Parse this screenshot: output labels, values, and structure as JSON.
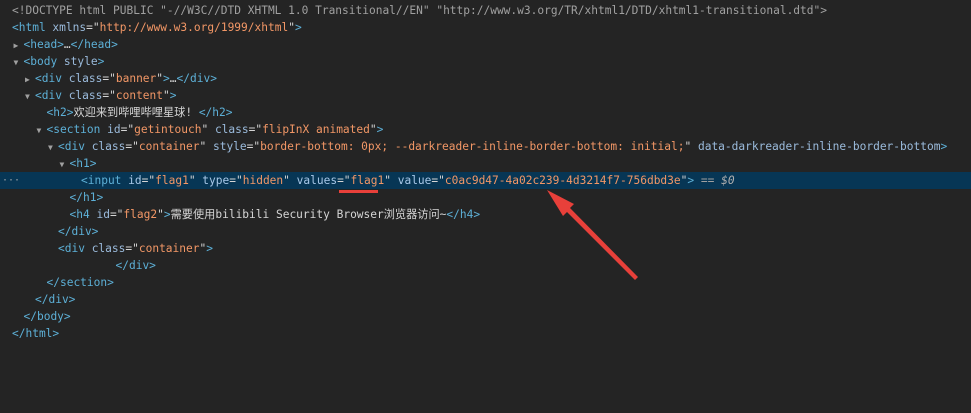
{
  "devtools": {
    "lines": [
      {
        "indent": 0,
        "toggle": "",
        "selected": false,
        "dots": "",
        "tokens": [
          {
            "k": "dim",
            "t": "<!DOCTYPE html PUBLIC \"-//W3C//DTD XHTML 1.0 Transitional//EN\" \"http://www.w3.org/TR/xhtml1/DTD/xhtml1-transitional.dtd\">"
          }
        ]
      },
      {
        "indent": 0,
        "toggle": "",
        "selected": false,
        "dots": "",
        "tokens": [
          {
            "k": "tag",
            "t": "<html"
          },
          {
            "k": "attr",
            "t": " xmlns"
          },
          {
            "k": "eq",
            "t": "=\""
          },
          {
            "k": "val",
            "t": "http://www.w3.org/1999/xhtml"
          },
          {
            "k": "eq",
            "t": "\""
          },
          {
            "k": "tag",
            "t": ">"
          }
        ]
      },
      {
        "indent": 1,
        "toggle": "▶",
        "selected": false,
        "dots": "",
        "tokens": [
          {
            "k": "tag",
            "t": "<head>"
          },
          {
            "k": "text",
            "t": "…"
          },
          {
            "k": "tag",
            "t": "</head>"
          }
        ]
      },
      {
        "indent": 1,
        "toggle": "▼",
        "selected": false,
        "dots": "",
        "tokens": [
          {
            "k": "tag",
            "t": "<body"
          },
          {
            "k": "attr",
            "t": " style"
          },
          {
            "k": "tag",
            "t": ">"
          }
        ]
      },
      {
        "indent": 2,
        "toggle": "▶",
        "selected": false,
        "dots": "",
        "tokens": [
          {
            "k": "tag",
            "t": "<div"
          },
          {
            "k": "attr",
            "t": " class"
          },
          {
            "k": "eq",
            "t": "=\""
          },
          {
            "k": "val",
            "t": "banner"
          },
          {
            "k": "eq",
            "t": "\""
          },
          {
            "k": "tag",
            "t": ">"
          },
          {
            "k": "text",
            "t": "…"
          },
          {
            "k": "tag",
            "t": "</div>"
          }
        ]
      },
      {
        "indent": 2,
        "toggle": "▼",
        "selected": false,
        "dots": "",
        "tokens": [
          {
            "k": "tag",
            "t": "<div"
          },
          {
            "k": "attr",
            "t": " class"
          },
          {
            "k": "eq",
            "t": "=\""
          },
          {
            "k": "val",
            "t": "content"
          },
          {
            "k": "eq",
            "t": "\""
          },
          {
            "k": "tag",
            "t": ">"
          }
        ]
      },
      {
        "indent": 3,
        "toggle": "",
        "selected": false,
        "dots": "",
        "tokens": [
          {
            "k": "tag",
            "t": "<h2>"
          },
          {
            "k": "text",
            "t": "欢迎来到哔哩哔哩星球! "
          },
          {
            "k": "tag",
            "t": "</h2>"
          }
        ]
      },
      {
        "indent": 3,
        "toggle": "▼",
        "selected": false,
        "dots": "",
        "tokens": [
          {
            "k": "tag",
            "t": "<section"
          },
          {
            "k": "attr",
            "t": " id"
          },
          {
            "k": "eq",
            "t": "=\""
          },
          {
            "k": "val",
            "t": "getintouch"
          },
          {
            "k": "eq",
            "t": "\""
          },
          {
            "k": "attr",
            "t": " class"
          },
          {
            "k": "eq",
            "t": "=\""
          },
          {
            "k": "val",
            "t": "flipInX animated"
          },
          {
            "k": "eq",
            "t": "\""
          },
          {
            "k": "tag",
            "t": ">"
          }
        ]
      },
      {
        "indent": 4,
        "toggle": "▼",
        "selected": false,
        "dots": "",
        "tokens": [
          {
            "k": "tag",
            "t": "<div"
          },
          {
            "k": "attr",
            "t": " class"
          },
          {
            "k": "eq",
            "t": "=\""
          },
          {
            "k": "val",
            "t": "container"
          },
          {
            "k": "eq",
            "t": "\""
          },
          {
            "k": "attr",
            "t": " style"
          },
          {
            "k": "eq",
            "t": "=\""
          },
          {
            "k": "val",
            "t": "border-bottom: 0px; --darkreader-inline-border-bottom: initial;"
          },
          {
            "k": "eq",
            "t": "\""
          },
          {
            "k": "attr",
            "t": " data-darkreader-inline-border-bottom"
          },
          {
            "k": "tag",
            "t": ">"
          }
        ]
      },
      {
        "indent": 5,
        "toggle": "▼",
        "selected": false,
        "dots": "",
        "tokens": [
          {
            "k": "tag",
            "t": "<h1>"
          }
        ]
      },
      {
        "indent": 6,
        "toggle": "",
        "selected": true,
        "dots": "···",
        "tokens": [
          {
            "k": "tag",
            "t": "<input"
          },
          {
            "k": "attr",
            "t": " id"
          },
          {
            "k": "eq",
            "t": "=\""
          },
          {
            "k": "val",
            "t": "flag1"
          },
          {
            "k": "eq",
            "t": "\""
          },
          {
            "k": "attr",
            "t": " type"
          },
          {
            "k": "eq",
            "t": "=\""
          },
          {
            "k": "val",
            "t": "hidden"
          },
          {
            "k": "eq",
            "t": "\""
          },
          {
            "k": "attr",
            "t": " values"
          },
          {
            "k": "eq",
            "t": "=\""
          },
          {
            "k": "val",
            "t": "flag1"
          },
          {
            "k": "eq",
            "t": "\""
          },
          {
            "k": "attr",
            "t": " value"
          },
          {
            "k": "eq",
            "t": "=\""
          },
          {
            "k": "val",
            "t": "c0ac9d47-4a02c239-4d3214f7-756dbd3e"
          },
          {
            "k": "eq",
            "t": "\""
          },
          {
            "k": "tag",
            "t": ">"
          },
          {
            "k": "dim",
            "t": " == "
          },
          {
            "k": "dollar",
            "t": "$0"
          }
        ]
      },
      {
        "indent": 5,
        "toggle": "",
        "selected": false,
        "dots": "",
        "tokens": [
          {
            "k": "tag",
            "t": "</h1>"
          }
        ]
      },
      {
        "indent": 5,
        "toggle": "",
        "selected": false,
        "dots": "",
        "tokens": [
          {
            "k": "tag",
            "t": "<h4"
          },
          {
            "k": "attr",
            "t": " id"
          },
          {
            "k": "eq",
            "t": "=\""
          },
          {
            "k": "val",
            "t": "flag2"
          },
          {
            "k": "eq",
            "t": "\""
          },
          {
            "k": "tag",
            "t": ">"
          },
          {
            "k": "text",
            "t": "需要使用bilibili Security Browser浏览器访问~"
          },
          {
            "k": "tag",
            "t": "</h4>"
          }
        ]
      },
      {
        "indent": 4,
        "toggle": "",
        "selected": false,
        "dots": "",
        "tokens": [
          {
            "k": "tag",
            "t": "</div>"
          }
        ]
      },
      {
        "indent": 4,
        "toggle": "",
        "selected": false,
        "dots": "",
        "tokens": [
          {
            "k": "tag",
            "t": "<div"
          },
          {
            "k": "attr",
            "t": " class"
          },
          {
            "k": "eq",
            "t": "=\""
          },
          {
            "k": "val",
            "t": "container"
          },
          {
            "k": "eq",
            "t": "\""
          },
          {
            "k": "tag",
            "t": ">"
          }
        ]
      },
      {
        "indent": 9,
        "toggle": "",
        "selected": false,
        "dots": "",
        "tokens": [
          {
            "k": "tag",
            "t": "</div>"
          }
        ]
      },
      {
        "indent": 3,
        "toggle": "",
        "selected": false,
        "dots": "",
        "tokens": [
          {
            "k": "tag",
            "t": "</section>"
          }
        ]
      },
      {
        "indent": 2,
        "toggle": "",
        "selected": false,
        "dots": "",
        "tokens": [
          {
            "k": "tag",
            "t": "</div>"
          }
        ]
      },
      {
        "indent": 1,
        "toggle": "",
        "selected": false,
        "dots": "",
        "tokens": [
          {
            "k": "tag",
            "t": "</body>"
          }
        ]
      },
      {
        "indent": 0,
        "toggle": "",
        "selected": false,
        "dots": "",
        "tokens": [
          {
            "k": "tag",
            "t": "</html>"
          }
        ]
      }
    ]
  },
  "annotations": {
    "underline_color": "#e8403a",
    "arrow_color": "#e8403a"
  },
  "colors": {
    "background": "#242424",
    "selected_row": "#073655",
    "tag": "#5db0d7",
    "attribute": "#9bbbdc",
    "value": "#f29766",
    "text": "#d5d5d5"
  }
}
